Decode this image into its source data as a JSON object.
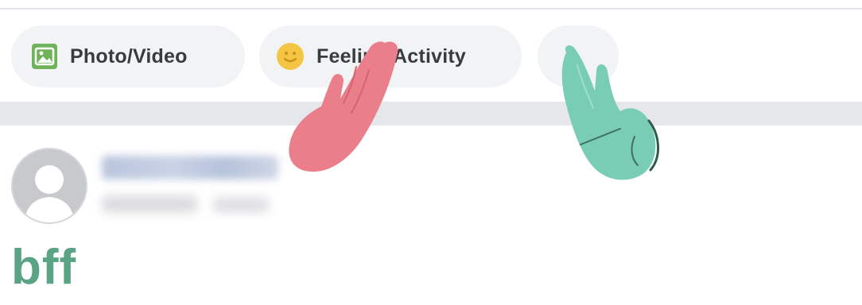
{
  "composer": {
    "actions": [
      {
        "label": "Photo/Video",
        "icon": "photo-icon"
      },
      {
        "label": "Feeling/Activity",
        "icon": "smile-icon"
      },
      {
        "label": "",
        "icon": "more-icon"
      }
    ]
  },
  "post": {
    "author_name": "",
    "text": "bff"
  },
  "colors": {
    "pill_bg": "#f2f3f5",
    "photo_green": "#6fb25a",
    "smile_yellow": "#f4c542",
    "post_text": "#5aa384",
    "hand_red": "#ea7f8b",
    "hand_green": "#79cdb5"
  }
}
